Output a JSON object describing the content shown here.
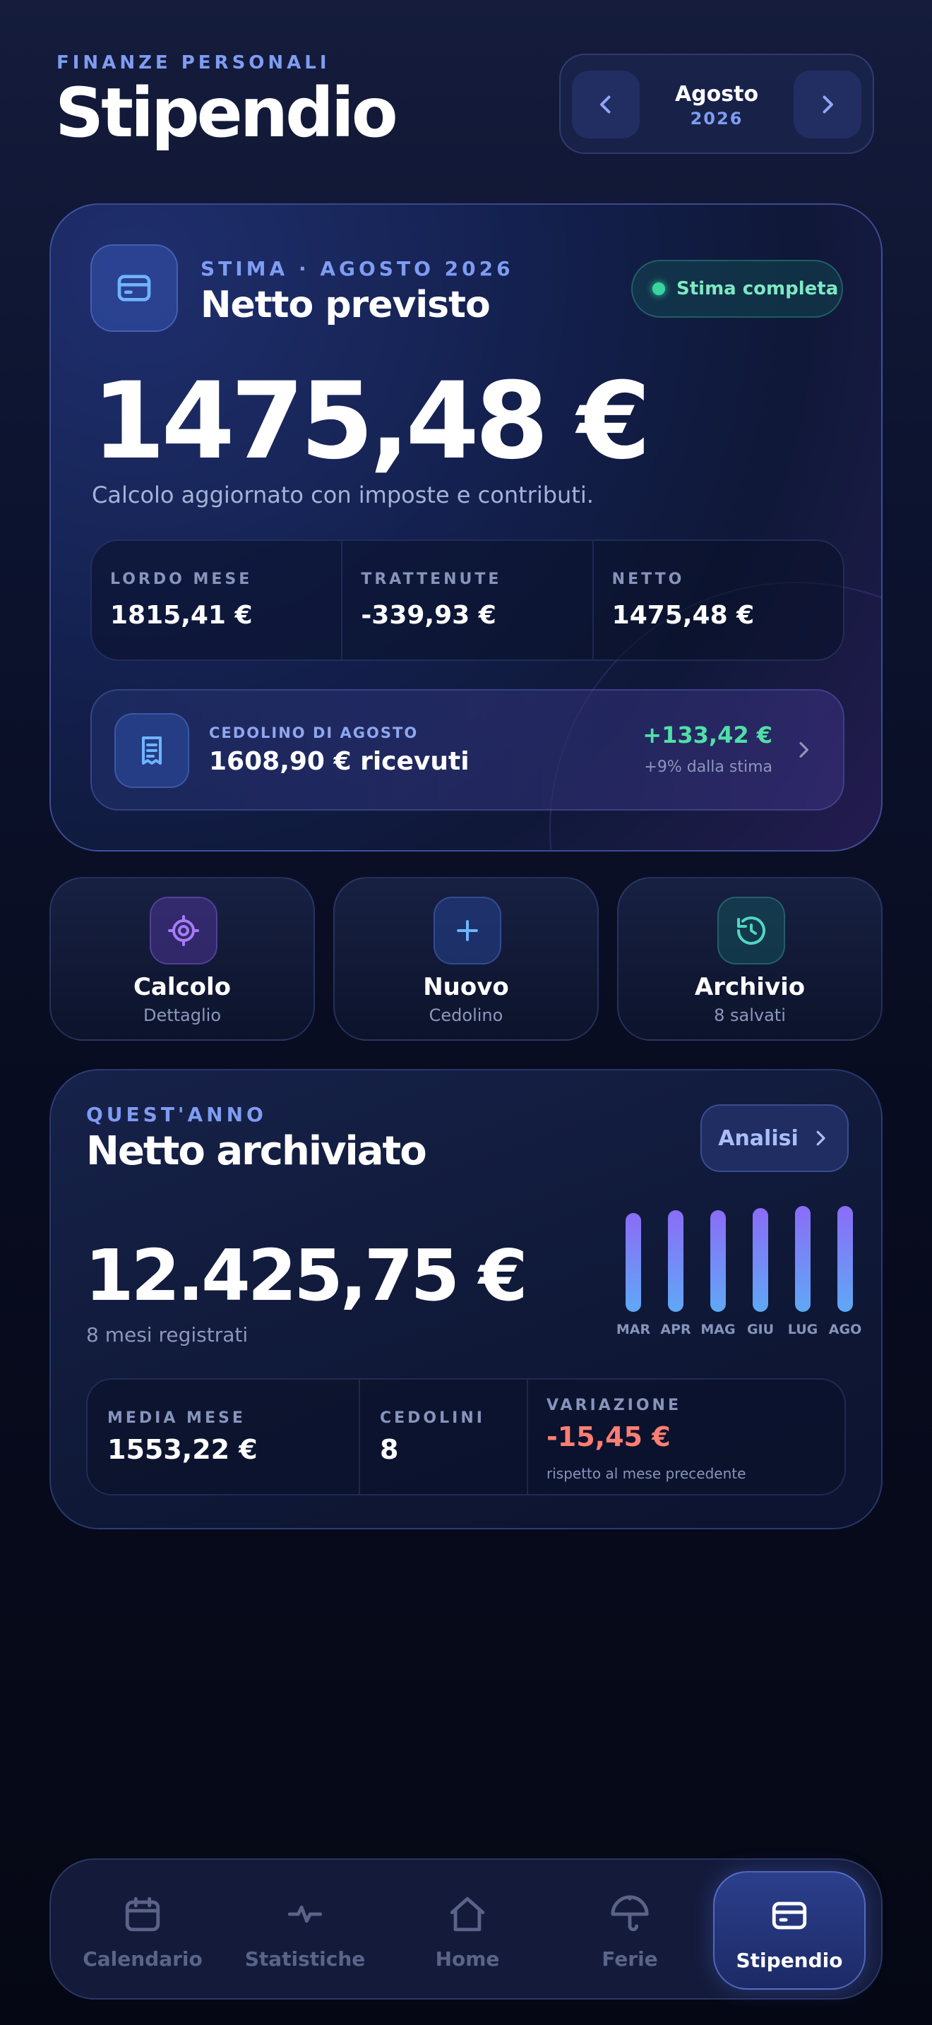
{
  "header": {
    "eyebrow": "FINANZE PERSONALI",
    "title": "Stipendio",
    "month": "Agosto",
    "year": "2026"
  },
  "hero": {
    "eyebrow": "STIMA · AGOSTO 2026",
    "title": "Netto previsto",
    "status": "Stima completa",
    "amount": "1475,48 €",
    "subtitle": "Calcolo aggiornato con imposte e contributi.",
    "stats": [
      {
        "label": "LORDO MESE",
        "value": "1815,41 €"
      },
      {
        "label": "TRATTENUTE",
        "value": "-339,93 €"
      },
      {
        "label": "NETTO",
        "value": "1475,48 €"
      }
    ],
    "payslip": {
      "label": "CEDOLINO DI AGOSTO",
      "value": "1608,90 € ricevuti",
      "delta": "+133,42 €",
      "delta_note": "+9% dalla stima"
    }
  },
  "actions": [
    {
      "title": "Calcolo",
      "subtitle": "Dettaglio",
      "icon": "target-icon"
    },
    {
      "title": "Nuovo",
      "subtitle": "Cedolino",
      "icon": "plus-icon"
    },
    {
      "title": "Archivio",
      "subtitle": "8 salvati",
      "icon": "history-icon"
    }
  ],
  "year": {
    "eyebrow": "QUEST'ANNO",
    "title": "Netto archiviato",
    "analysis_label": "Analisi",
    "amount": "12.425,75 €",
    "subtitle": "8 mesi registrati",
    "chart": {
      "months": [
        "MAR",
        "APR",
        "MAG",
        "GIU",
        "LUG",
        "AGO"
      ],
      "relative_heights": [
        0.93,
        0.96,
        0.96,
        0.98,
        1.0,
        1.0
      ]
    },
    "stats": {
      "avg_label": "MEDIA MESE",
      "avg_value": "1553,22 €",
      "count_label": "CEDOLINI",
      "count_value": "8",
      "change_label": "VARIAZIONE",
      "change_value": "-15,45 €",
      "change_note": "rispetto al mese precedente"
    }
  },
  "nav": [
    {
      "label": "Calendario",
      "icon": "calendar-icon"
    },
    {
      "label": "Statistiche",
      "icon": "pulse-icon"
    },
    {
      "label": "Home",
      "icon": "home-icon"
    },
    {
      "label": "Ferie",
      "icon": "umbrella-icon"
    },
    {
      "label": "Stipendio",
      "icon": "wallet-icon",
      "active": true
    }
  ],
  "colors": {
    "accent": "#7f9cf2",
    "positive": "#4fe0a8",
    "negative": "#ff7e73",
    "status": "#37d6a0"
  }
}
